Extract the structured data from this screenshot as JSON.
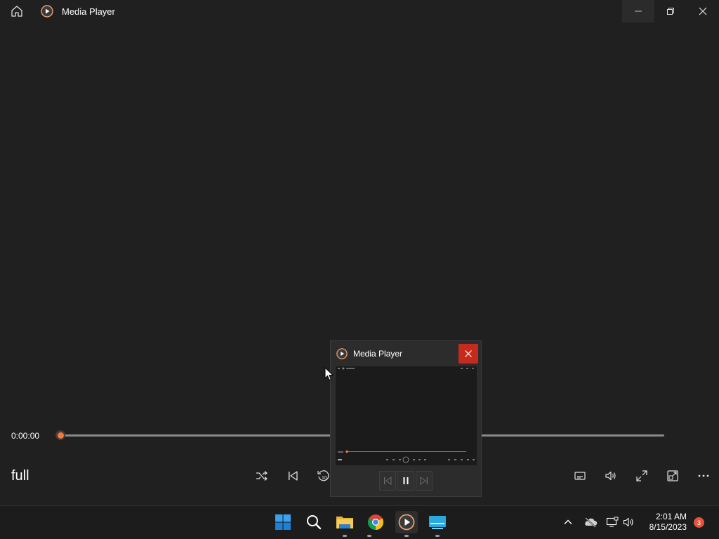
{
  "window": {
    "title": "Media Player",
    "icons": {
      "home": "home-icon",
      "logo": "media-player-logo-icon",
      "minimize": "minimize-icon",
      "restore": "restore-icon",
      "close": "close-icon"
    }
  },
  "player": {
    "current_time": "0:00:00",
    "progress_fraction": 0.0,
    "media_title": "full",
    "accent_color": "#ef7a3f",
    "controls_left": [
      "shuffle-icon",
      "previous-icon",
      "rewind-10-icon"
    ],
    "controls_right": [
      "captions-icon",
      "volume-icon",
      "fullscreen-icon",
      "mini-player-icon",
      "more-icon"
    ]
  },
  "preview": {
    "title": "Media Player",
    "close_color": "#c42b1c",
    "buttons": [
      "skip-back-icon",
      "pause-icon",
      "skip-forward-icon"
    ]
  },
  "taskbar": {
    "apps": [
      "windows-start-icon",
      "search-icon",
      "file-explorer-icon",
      "chrome-icon",
      "media-player-icon",
      "screen-app-icon"
    ],
    "tray": [
      "chevron-up-icon",
      "onedrive-icon",
      "network-icon",
      "speaker-icon"
    ],
    "time": "2:01 AM",
    "date": "8/15/2023",
    "notification_count": "3"
  }
}
